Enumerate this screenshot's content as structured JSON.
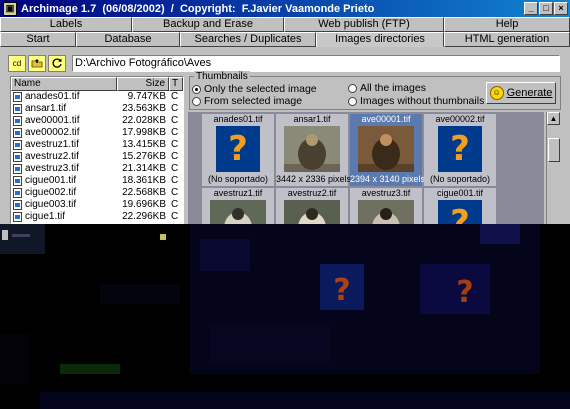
{
  "window": {
    "title": "Archimage 1.7  (06/08/2002)  /  Copyright:  F.Javier Vaamonde Prieto",
    "buttons": {
      "minimize": "_",
      "maximize": "□",
      "close": "×"
    }
  },
  "tabs_row1": [
    {
      "label": "Labels"
    },
    {
      "label": "Backup and Erase"
    },
    {
      "label": "Web publish  (FTP)"
    },
    {
      "label": "Help"
    }
  ],
  "tabs_row2": [
    {
      "label": "Start"
    },
    {
      "label": "Database"
    },
    {
      "label": "Searches / Duplicates"
    },
    {
      "label": "Images directories",
      "active": true
    },
    {
      "label": "HTML generation"
    }
  ],
  "pathbar": {
    "cd_label": "cd",
    "up_icon": "folder-up-icon",
    "refresh_icon": "refresh-icon",
    "path": "D:\\Archivo Fotográfico\\Aves"
  },
  "filelist": {
    "columns": {
      "name": "Name",
      "size": "Size",
      "type": "T"
    },
    "rows": [
      {
        "name": "anades01.tif",
        "size": "9.747KB",
        "type": "C"
      },
      {
        "name": "ansar1.tif",
        "size": "23.563KB",
        "type": "C"
      },
      {
        "name": "ave00001.tif",
        "size": "22.028KB",
        "type": "C"
      },
      {
        "name": "ave00002.tif",
        "size": "17.998KB",
        "type": "C"
      },
      {
        "name": "avestruz1.tif",
        "size": "13.415KB",
        "type": "C"
      },
      {
        "name": "avestruz2.tif",
        "size": "15.276KB",
        "type": "C"
      },
      {
        "name": "avestruz3.tif",
        "size": "21.314KB",
        "type": "C"
      },
      {
        "name": "cigue001.tif",
        "size": "18.361KB",
        "type": "C"
      },
      {
        "name": "cigue002.tif",
        "size": "22.568KB",
        "type": "C"
      },
      {
        "name": "cigue003.tif",
        "size": "19.696KB",
        "type": "C"
      },
      {
        "name": "cigue1.tif",
        "size": "22.296KB",
        "type": "C"
      }
    ]
  },
  "thumbnails_group": {
    "legend": "Thumbnails",
    "options": {
      "only_selected": "Only the selected image",
      "from_selected": "From selected image",
      "all": "All the images",
      "without": "Images without thumbnails"
    },
    "generate_label": "Generate"
  },
  "thumbs": [
    {
      "name": "anades01.tif",
      "caption": "(No soportado)",
      "kind": "unsupported"
    },
    {
      "name": "ansar1.tif",
      "caption": "3442 x 2336 pixels",
      "kind": "photo"
    },
    {
      "name": "ave00001.tif",
      "caption": "2394 x 3140 pixels",
      "kind": "photo",
      "selected": true
    },
    {
      "name": "ave00002.tif",
      "caption": "(No soportado)",
      "kind": "unsupported"
    },
    {
      "name": "avestruz1.tif",
      "caption": "",
      "kind": "photo"
    },
    {
      "name": "avestruz2.tif",
      "caption": "",
      "kind": "photo"
    },
    {
      "name": "avestruz3.tif",
      "caption": "",
      "kind": "photo"
    },
    {
      "name": "cigue001.tif",
      "caption": "",
      "kind": "unsupported"
    }
  ],
  "colors": {
    "titlebar": "#000080",
    "selected_thumb": "#5a7ab0",
    "unsupported_bg": "#003a8c",
    "question_mark": "#f0a020"
  }
}
